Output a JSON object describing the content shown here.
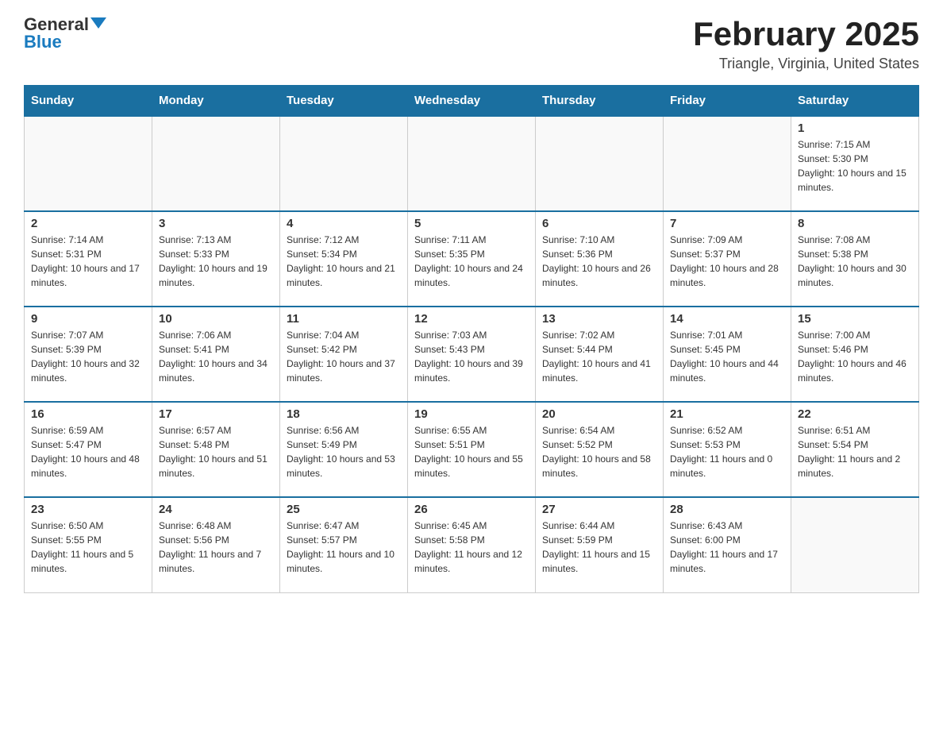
{
  "header": {
    "logo_general": "General",
    "logo_blue": "Blue",
    "month_title": "February 2025",
    "location": "Triangle, Virginia, United States"
  },
  "days_of_week": [
    "Sunday",
    "Monday",
    "Tuesday",
    "Wednesday",
    "Thursday",
    "Friday",
    "Saturday"
  ],
  "weeks": [
    [
      {
        "day": "",
        "info": ""
      },
      {
        "day": "",
        "info": ""
      },
      {
        "day": "",
        "info": ""
      },
      {
        "day": "",
        "info": ""
      },
      {
        "day": "",
        "info": ""
      },
      {
        "day": "",
        "info": ""
      },
      {
        "day": "1",
        "info": "Sunrise: 7:15 AM\nSunset: 5:30 PM\nDaylight: 10 hours and 15 minutes."
      }
    ],
    [
      {
        "day": "2",
        "info": "Sunrise: 7:14 AM\nSunset: 5:31 PM\nDaylight: 10 hours and 17 minutes."
      },
      {
        "day": "3",
        "info": "Sunrise: 7:13 AM\nSunset: 5:33 PM\nDaylight: 10 hours and 19 minutes."
      },
      {
        "day": "4",
        "info": "Sunrise: 7:12 AM\nSunset: 5:34 PM\nDaylight: 10 hours and 21 minutes."
      },
      {
        "day": "5",
        "info": "Sunrise: 7:11 AM\nSunset: 5:35 PM\nDaylight: 10 hours and 24 minutes."
      },
      {
        "day": "6",
        "info": "Sunrise: 7:10 AM\nSunset: 5:36 PM\nDaylight: 10 hours and 26 minutes."
      },
      {
        "day": "7",
        "info": "Sunrise: 7:09 AM\nSunset: 5:37 PM\nDaylight: 10 hours and 28 minutes."
      },
      {
        "day": "8",
        "info": "Sunrise: 7:08 AM\nSunset: 5:38 PM\nDaylight: 10 hours and 30 minutes."
      }
    ],
    [
      {
        "day": "9",
        "info": "Sunrise: 7:07 AM\nSunset: 5:39 PM\nDaylight: 10 hours and 32 minutes."
      },
      {
        "day": "10",
        "info": "Sunrise: 7:06 AM\nSunset: 5:41 PM\nDaylight: 10 hours and 34 minutes."
      },
      {
        "day": "11",
        "info": "Sunrise: 7:04 AM\nSunset: 5:42 PM\nDaylight: 10 hours and 37 minutes."
      },
      {
        "day": "12",
        "info": "Sunrise: 7:03 AM\nSunset: 5:43 PM\nDaylight: 10 hours and 39 minutes."
      },
      {
        "day": "13",
        "info": "Sunrise: 7:02 AM\nSunset: 5:44 PM\nDaylight: 10 hours and 41 minutes."
      },
      {
        "day": "14",
        "info": "Sunrise: 7:01 AM\nSunset: 5:45 PM\nDaylight: 10 hours and 44 minutes."
      },
      {
        "day": "15",
        "info": "Sunrise: 7:00 AM\nSunset: 5:46 PM\nDaylight: 10 hours and 46 minutes."
      }
    ],
    [
      {
        "day": "16",
        "info": "Sunrise: 6:59 AM\nSunset: 5:47 PM\nDaylight: 10 hours and 48 minutes."
      },
      {
        "day": "17",
        "info": "Sunrise: 6:57 AM\nSunset: 5:48 PM\nDaylight: 10 hours and 51 minutes."
      },
      {
        "day": "18",
        "info": "Sunrise: 6:56 AM\nSunset: 5:49 PM\nDaylight: 10 hours and 53 minutes."
      },
      {
        "day": "19",
        "info": "Sunrise: 6:55 AM\nSunset: 5:51 PM\nDaylight: 10 hours and 55 minutes."
      },
      {
        "day": "20",
        "info": "Sunrise: 6:54 AM\nSunset: 5:52 PM\nDaylight: 10 hours and 58 minutes."
      },
      {
        "day": "21",
        "info": "Sunrise: 6:52 AM\nSunset: 5:53 PM\nDaylight: 11 hours and 0 minutes."
      },
      {
        "day": "22",
        "info": "Sunrise: 6:51 AM\nSunset: 5:54 PM\nDaylight: 11 hours and 2 minutes."
      }
    ],
    [
      {
        "day": "23",
        "info": "Sunrise: 6:50 AM\nSunset: 5:55 PM\nDaylight: 11 hours and 5 minutes."
      },
      {
        "day": "24",
        "info": "Sunrise: 6:48 AM\nSunset: 5:56 PM\nDaylight: 11 hours and 7 minutes."
      },
      {
        "day": "25",
        "info": "Sunrise: 6:47 AM\nSunset: 5:57 PM\nDaylight: 11 hours and 10 minutes."
      },
      {
        "day": "26",
        "info": "Sunrise: 6:45 AM\nSunset: 5:58 PM\nDaylight: 11 hours and 12 minutes."
      },
      {
        "day": "27",
        "info": "Sunrise: 6:44 AM\nSunset: 5:59 PM\nDaylight: 11 hours and 15 minutes."
      },
      {
        "day": "28",
        "info": "Sunrise: 6:43 AM\nSunset: 6:00 PM\nDaylight: 11 hours and 17 minutes."
      },
      {
        "day": "",
        "info": ""
      }
    ]
  ]
}
